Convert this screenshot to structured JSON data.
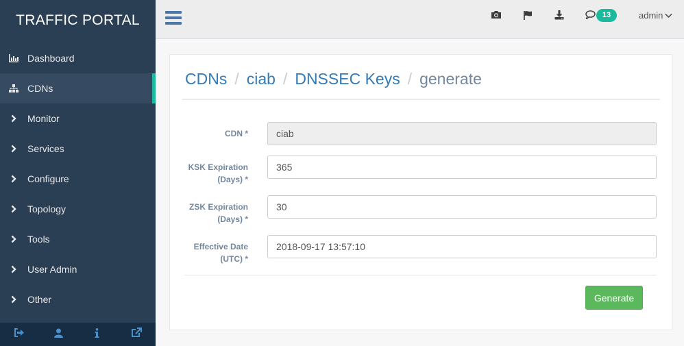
{
  "brand": "TRAFFIC PORTAL",
  "nav": [
    {
      "label": "Dashboard",
      "icon": "bar-chart-icon",
      "active": false
    },
    {
      "label": "CDNs",
      "icon": "sitemap-icon",
      "active": true
    },
    {
      "label": "Monitor",
      "icon": "chevron-right-icon",
      "active": false
    },
    {
      "label": "Services",
      "icon": "chevron-right-icon",
      "active": false
    },
    {
      "label": "Configure",
      "icon": "chevron-right-icon",
      "active": false
    },
    {
      "label": "Topology",
      "icon": "chevron-right-icon",
      "active": false
    },
    {
      "label": "Tools",
      "icon": "chevron-right-icon",
      "active": false
    },
    {
      "label": "User Admin",
      "icon": "chevron-right-icon",
      "active": false
    },
    {
      "label": "Other",
      "icon": "chevron-right-icon",
      "active": false
    }
  ],
  "topbar": {
    "notification_count": "13",
    "user": "admin"
  },
  "breadcrumb": {
    "cdns": "CDNs",
    "cdn": "ciab",
    "keys": "DNSSEC Keys",
    "current": "generate",
    "separator": "/"
  },
  "form": {
    "cdn_label": "CDN *",
    "cdn_value": "ciab",
    "ksk_label_1": "KSK Expiration",
    "ksk_label_2": "(Days) *",
    "ksk_value": "365",
    "zsk_label_1": "ZSK Expiration",
    "zsk_label_2": "(Days) *",
    "zsk_value": "30",
    "date_label_1": "Effective Date",
    "date_label_2": "(UTC) *",
    "date_value": "2018-09-17 13:57:10",
    "submit_label": "Generate"
  },
  "colors": {
    "sidebar": "#2a3f54",
    "accent": "#1abb9c",
    "link": "#337ab7",
    "success": "#5cb85c"
  }
}
